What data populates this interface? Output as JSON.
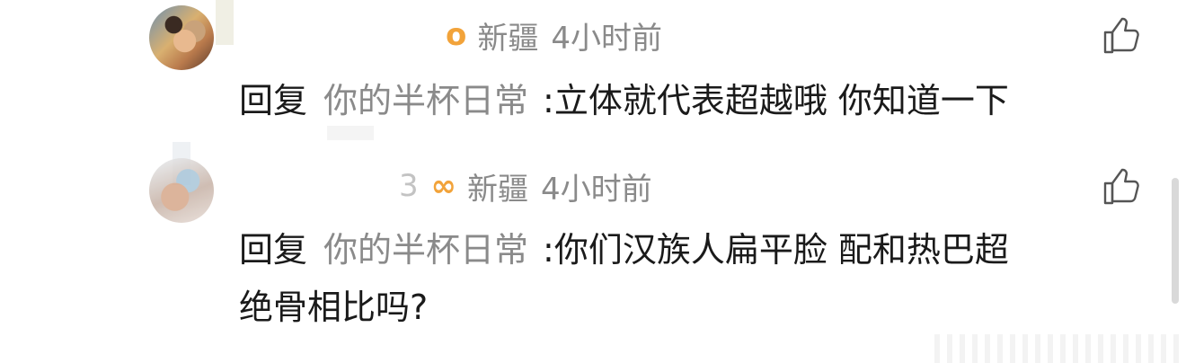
{
  "comments": [
    {
      "name_tail": "",
      "badge_icon": "o",
      "location": "新疆",
      "time": "4小时前",
      "reply_keyword": "回复",
      "mention": "你的半杯日常",
      "text": ":立体就代表超越哦 你知道一下",
      "like_icon": "thumbs-up-icon"
    },
    {
      "name_tail": "3",
      "badge_icon": "∞",
      "location": "新疆",
      "time": "4小时前",
      "reply_keyword": "回复",
      "mention": "你的半杯日常",
      "text_line1": ":你们汉族人扁平脸 配和热巴超",
      "text_line2": "绝骨相比吗?",
      "like_icon": "thumbs-up-icon"
    }
  ],
  "colors": {
    "meta_gray": "#8a8a8a",
    "badge_orange": "#f2a33a",
    "text_dark": "#1a1a1a"
  }
}
